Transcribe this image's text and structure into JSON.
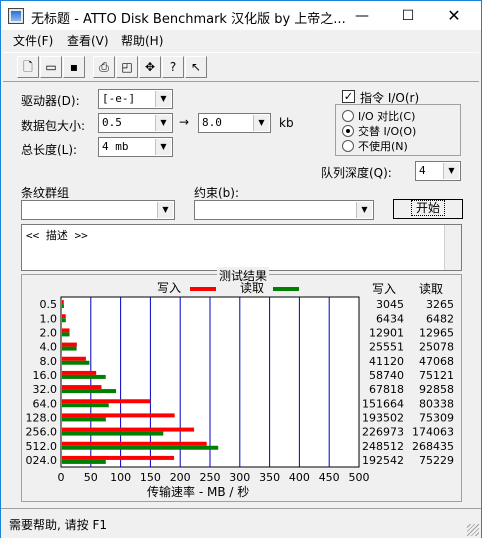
{
  "window": {
    "title": "无标题 - ATTO Disk Benchmark 汉化版 by 上帝之...",
    "minimize": "—",
    "maximize": "☐",
    "close": "✕"
  },
  "menu": [
    {
      "label": "文件(F)"
    },
    {
      "label": "查看(V)"
    },
    {
      "label": "帮助(H)"
    }
  ],
  "toolbar": [
    {
      "icon": "new-document-icon",
      "glyph": "🗋"
    },
    {
      "icon": "open-folder-icon",
      "glyph": "📂"
    },
    {
      "icon": "save-icon",
      "glyph": "💾"
    },
    {
      "icon": "print-icon",
      "glyph": "🖶"
    },
    {
      "icon": "print-preview-icon",
      "glyph": "🔍"
    },
    {
      "icon": "move-icon",
      "glyph": "✥"
    },
    {
      "icon": "help-icon",
      "glyph": "?"
    },
    {
      "icon": "context-help-icon",
      "glyph": "↖?"
    }
  ],
  "settings": {
    "drive_label": "驱动器(D):",
    "drive_value": "[-e-]",
    "transfer_label": "数据包大小:",
    "transfer_from": "0.5",
    "transfer_arrow": "→",
    "transfer_to": "8.0",
    "transfer_unit": "kb",
    "total_label": "总长度(L):",
    "total_value": "4 mb",
    "overlapped_label": "指令 I/O(r)",
    "overlapped_checked": true,
    "io_options": [
      "I/O 对比(C)",
      "交替 I/O(O)",
      "不使用(N)"
    ],
    "io_selected": 1,
    "queue_label": "队列深度(Q):",
    "queue_value": "4",
    "stripe_label": "条纹群组",
    "stripe_value": "",
    "constraint_label": "约束(b):",
    "constraint_value": "",
    "start_button": "开始",
    "description": "<< 描述 >>"
  },
  "results": {
    "title": "测试结果",
    "write_label": "写入",
    "read_label": "读取",
    "col_write": "写入",
    "col_read": "读取",
    "x_axis_label": "传输速率 - MB / 秒",
    "write_color": "#ff0000",
    "read_color": "#008000",
    "grid_color": "#0000c0"
  },
  "chart_data": {
    "type": "bar",
    "orientation": "horizontal",
    "title": "测试结果",
    "xlabel": "传输速率 - MB / 秒",
    "xlim": [
      0,
      500
    ],
    "x_ticks": [
      "0",
      "50",
      "100",
      "150",
      "200",
      "250",
      "300",
      "350",
      "400",
      "450",
      "500"
    ],
    "categories": [
      "0.5",
      "1.0",
      "2.0",
      "4.0",
      "8.0",
      "16.0",
      "32.0",
      "64.0",
      "128.0",
      "256.0",
      "512.0",
      "024.0"
    ],
    "series": [
      {
        "name": "写入",
        "values_kbps": [
          3045,
          6434,
          12901,
          25551,
          41120,
          58740,
          67818,
          151664,
          193502,
          226973,
          248512,
          192542
        ]
      },
      {
        "name": "读取",
        "values_kbps": [
          3265,
          6482,
          12965,
          25078,
          47068,
          75121,
          92858,
          80338,
          75309,
          174063,
          268435,
          75229
        ]
      }
    ]
  },
  "status": {
    "text": "需要帮助, 请按 F1"
  }
}
